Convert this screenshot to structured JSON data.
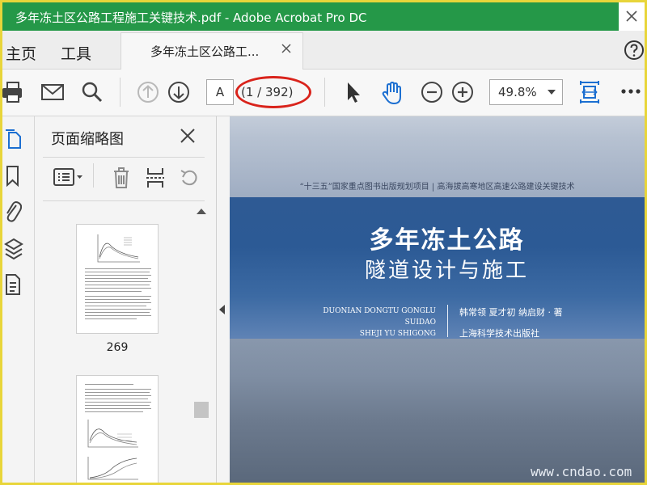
{
  "window": {
    "title": "多年冻土区公路工程施工关键技术.pdf - Adobe Acrobat Pro DC"
  },
  "tabs": {
    "home": "主页",
    "tools": "工具",
    "document": "多年冻土区公路工..."
  },
  "toolbar": {
    "page_input": "A",
    "page_count": "(1 / 392)",
    "zoom": "49.8%"
  },
  "sidebar_icons": [
    "pages-icon",
    "bookmark-icon",
    "attachment-icon",
    "layers-icon",
    "document-icon"
  ],
  "thumbnails_panel": {
    "title": "页面缩略图",
    "pages": [
      {
        "label": "269"
      },
      {
        "label": ""
      }
    ]
  },
  "document": {
    "series": "“十三五”国家重点图书出版规划项目 | 高海拔高寒地区高速公路建设关键技术",
    "title": "多年冻土公路",
    "subtitle": "隧道设计与施工",
    "pinyin": [
      "DUONIAN DONGTU GONGLU",
      "SUIDAO",
      "SHEJI YU SHIGONG"
    ],
    "authors": "韩常领   夏才初   纳启财 · 著",
    "publisher": "上海科学技术出版社"
  },
  "watermark": "www.cndao.com",
  "colors": {
    "titlebar": "#259848",
    "highlight_oval": "#d9231b",
    "accent_blue": "#1c6fd1"
  }
}
